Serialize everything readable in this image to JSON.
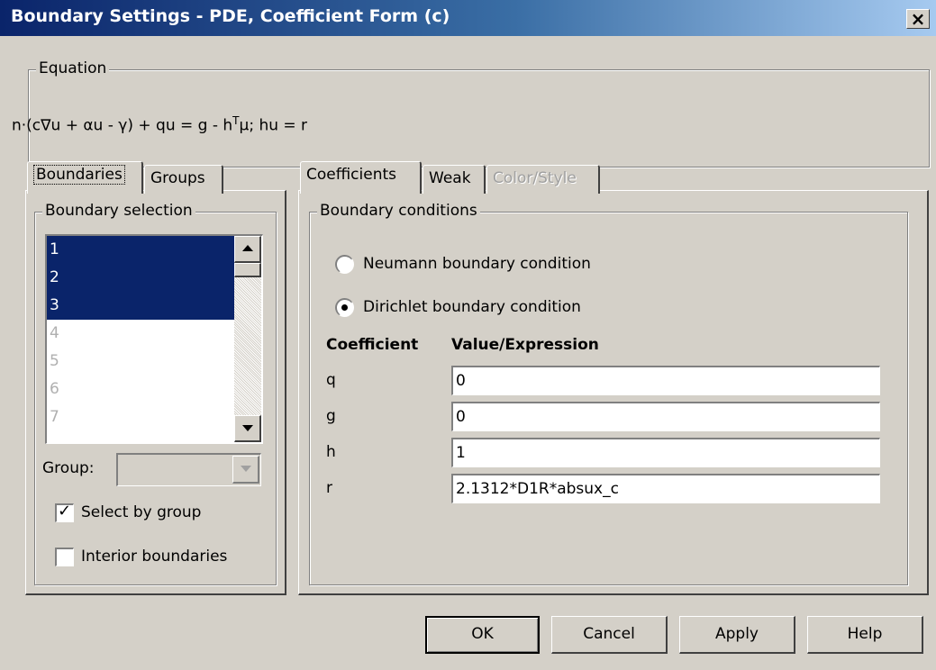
{
  "window": {
    "title": "Boundary Settings - PDE, Coefficient Form (c)",
    "close": "×"
  },
  "equation": {
    "legend": "Equation",
    "text_before_sup": "n·(c∇u + αu - γ) + qu = g - h",
    "sup": "T",
    "text_after_sup": "μ; hu = r"
  },
  "left_tabs": [
    {
      "label": "Boundaries"
    },
    {
      "label": "Groups"
    }
  ],
  "boundary_selection": {
    "legend": "Boundary selection",
    "items": [
      {
        "label": "1",
        "state": "selected"
      },
      {
        "label": "2",
        "state": "selected"
      },
      {
        "label": "3",
        "state": "selected"
      },
      {
        "label": "4",
        "state": "disabled"
      },
      {
        "label": "5",
        "state": "disabled"
      },
      {
        "label": "6",
        "state": "disabled"
      },
      {
        "label": "7",
        "state": "disabled"
      }
    ],
    "group_label": "Group:",
    "group_value": "",
    "select_by_group": {
      "label": "Select by group",
      "checked": true
    },
    "interior_boundaries": {
      "label": "Interior boundaries",
      "checked": false
    }
  },
  "right_tabs": [
    {
      "label": "Coefficients"
    },
    {
      "label": "Weak"
    },
    {
      "label": "Color/Style"
    }
  ],
  "boundary_conditions": {
    "legend": "Boundary conditions",
    "neumann": {
      "label": "Neumann boundary condition",
      "selected": false
    },
    "dirichlet": {
      "label": "Dirichlet boundary condition",
      "selected": true
    },
    "col_coefficient": "Coefficient",
    "col_value": "Value/Expression",
    "rows": [
      {
        "name": "q",
        "value": "0"
      },
      {
        "name": "g",
        "value": "0"
      },
      {
        "name": "h",
        "value": "1"
      },
      {
        "name": "r",
        "value": "2.1312*D1R*absux_c"
      }
    ]
  },
  "buttons": {
    "ok": "OK",
    "cancel": "Cancel",
    "apply": "Apply",
    "help": "Help"
  },
  "colors": {
    "titlebar_start": "#0a246a",
    "titlebar_end": "#a6caf0",
    "selection": "#0a246a",
    "face": "#d4d0c8"
  }
}
